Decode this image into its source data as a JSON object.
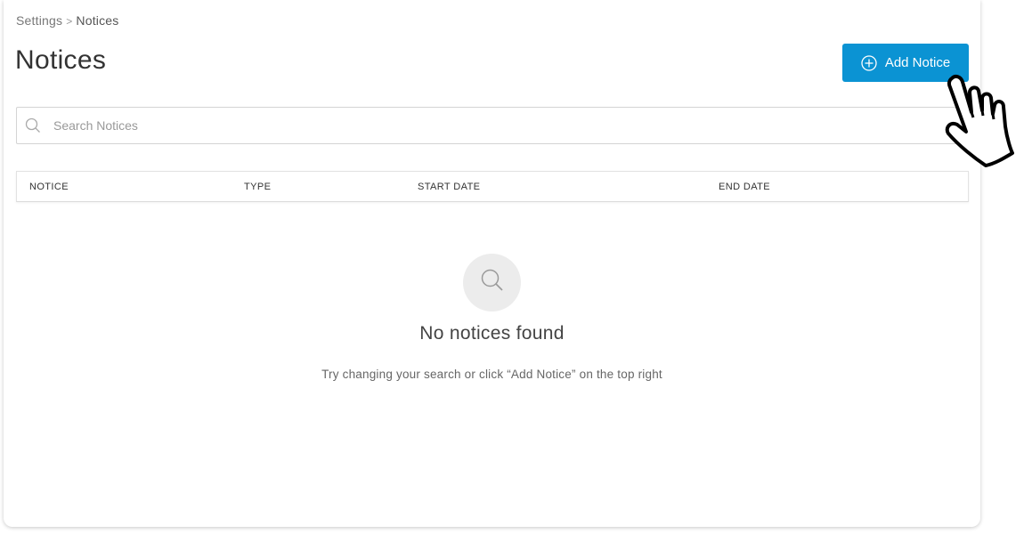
{
  "breadcrumb": {
    "parent": "Settings",
    "separator": ">",
    "current": "Notices"
  },
  "page": {
    "title": "Notices"
  },
  "toolbar": {
    "add_label": "Add Notice",
    "add_icon": "plus-circle-icon",
    "accent_color": "#0b93d3"
  },
  "search": {
    "placeholder": "Search Notices",
    "value": "",
    "icon": "search-icon"
  },
  "table": {
    "columns": [
      "NOTICE",
      "TYPE",
      "START DATE",
      "END DATE"
    ],
    "rows": []
  },
  "empty_state": {
    "icon": "search-icon",
    "title": "No notices found",
    "hint": "Try changing your search or click “Add Notice” on the top right"
  },
  "cursor": {
    "icon": "hand-pointer-icon"
  }
}
